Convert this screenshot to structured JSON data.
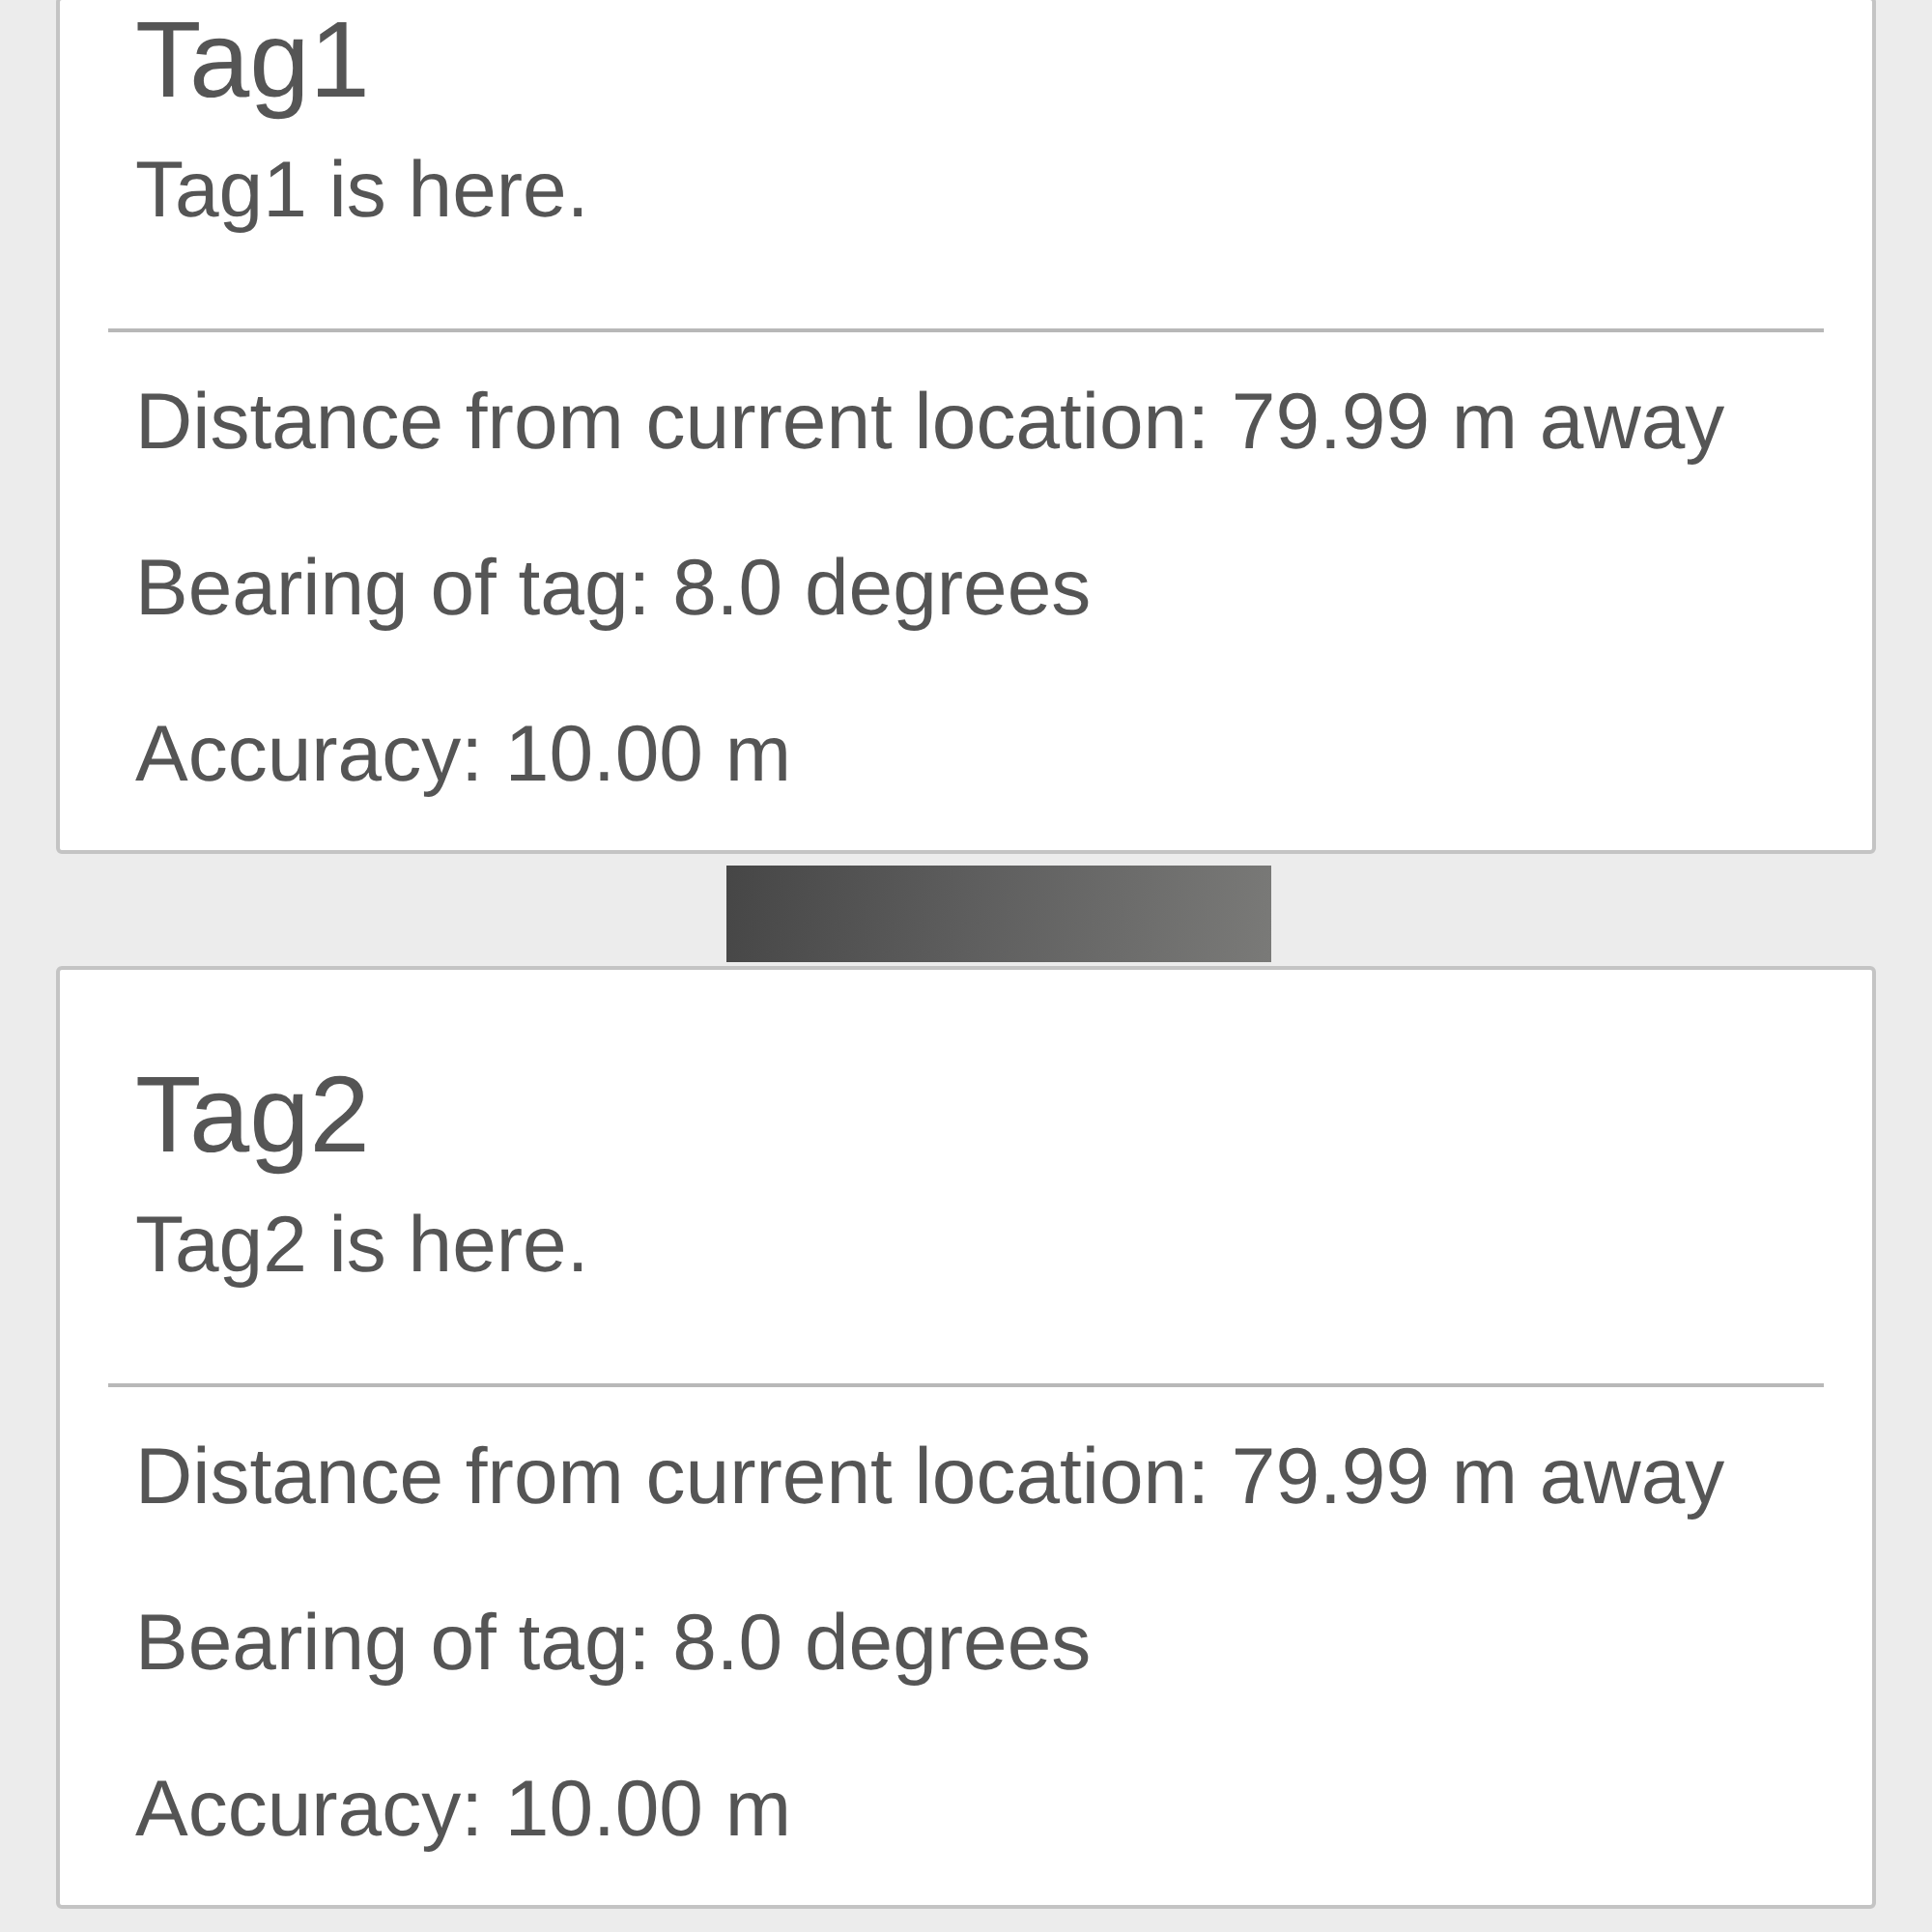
{
  "tags": [
    {
      "title": "Tag1",
      "description": "Tag1 is here.",
      "details": [
        "Distance from current location: 79.99 m away",
        "Bearing of tag: 8.0 degrees",
        "Accuracy: 10.00 m"
      ]
    },
    {
      "title": "Tag2",
      "description": "Tag2 is here.",
      "details": [
        "Distance from current location: 79.99 m away",
        "Bearing of tag: 8.0 degrees",
        "Accuracy: 10.00 m"
      ]
    }
  ]
}
